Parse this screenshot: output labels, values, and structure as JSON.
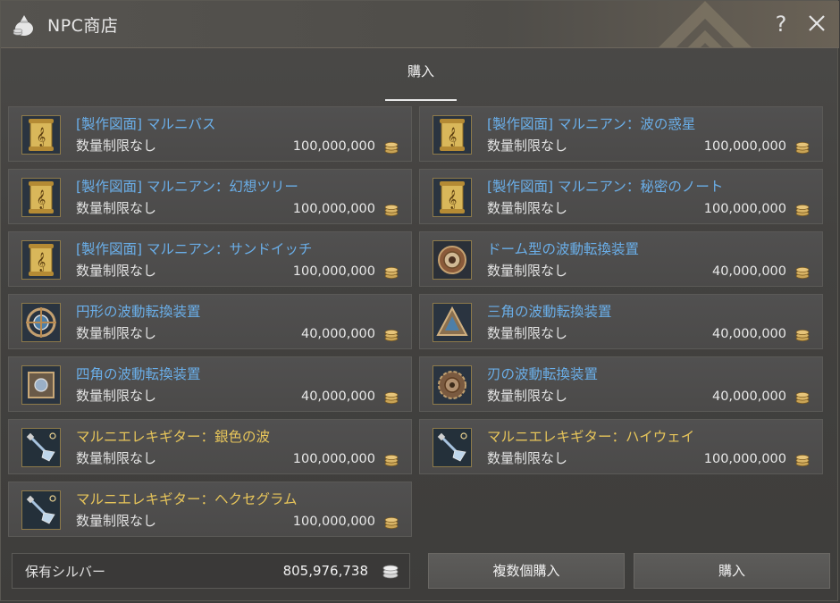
{
  "window": {
    "title": "NPC商店",
    "help_label": "?",
    "icons": {
      "title": "money-bag-icon",
      "close": "close-icon"
    }
  },
  "tabs": [
    {
      "label": "購入",
      "active": true
    }
  ],
  "items": [
    {
      "name": "[製作図面] マルニバス",
      "limit": "数量制限なし",
      "price": "100,000,000",
      "icon": "scroll-icon",
      "name_color": "#6aaee8"
    },
    {
      "name": "[製作図面] マルニアン：波の惑星",
      "limit": "数量制限なし",
      "price": "100,000,000",
      "icon": "scroll-icon",
      "name_color": "#6aaee8"
    },
    {
      "name": "[製作図面] マルニアン：幻想ツリー",
      "limit": "数量制限なし",
      "price": "100,000,000",
      "icon": "scroll-icon",
      "name_color": "#6aaee8"
    },
    {
      "name": "[製作図面] マルニアン：秘密のノート",
      "limit": "数量制限なし",
      "price": "100,000,000",
      "icon": "scroll-icon",
      "name_color": "#6aaee8"
    },
    {
      "name": "[製作図面] マルニアン：サンドイッチ",
      "limit": "数量制限なし",
      "price": "100,000,000",
      "icon": "scroll-icon",
      "name_color": "#6aaee8"
    },
    {
      "name": "ドーム型の波動転換装置",
      "limit": "数量制限なし",
      "price": "40,000,000",
      "icon": "dome-device-icon",
      "name_color": "#6aaee8"
    },
    {
      "name": "円形の波動転換装置",
      "limit": "数量制限なし",
      "price": "40,000,000",
      "icon": "circle-device-icon",
      "name_color": "#6aaee8"
    },
    {
      "name": "三角の波動転換装置",
      "limit": "数量制限なし",
      "price": "40,000,000",
      "icon": "triangle-device-icon",
      "name_color": "#6aaee8"
    },
    {
      "name": "四角の波動転換装置",
      "limit": "数量制限なし",
      "price": "40,000,000",
      "icon": "square-device-icon",
      "name_color": "#6aaee8"
    },
    {
      "name": "刃の波動転換装置",
      "limit": "数量制限なし",
      "price": "40,000,000",
      "icon": "blade-device-icon",
      "name_color": "#6aaee8"
    },
    {
      "name": "マルニエレキギター：銀色の波",
      "limit": "数量制限なし",
      "price": "100,000,000",
      "icon": "guitar-icon",
      "name_color": "#e7c55a"
    },
    {
      "name": "マルニエレキギター：ハイウェイ",
      "limit": "数量制限なし",
      "price": "100,000,000",
      "icon": "guitar-icon",
      "name_color": "#e7c55a"
    },
    {
      "name": "マルニエレキギター：ヘクセグラム",
      "limit": "数量制限なし",
      "price": "100,000,000",
      "icon": "guitar-icon",
      "name_color": "#e7c55a"
    }
  ],
  "footer": {
    "silver_label": "保有シルバー",
    "silver_value": "805,976,738",
    "bulk_buy_label": "複数個購入",
    "buy_label": "購入"
  }
}
